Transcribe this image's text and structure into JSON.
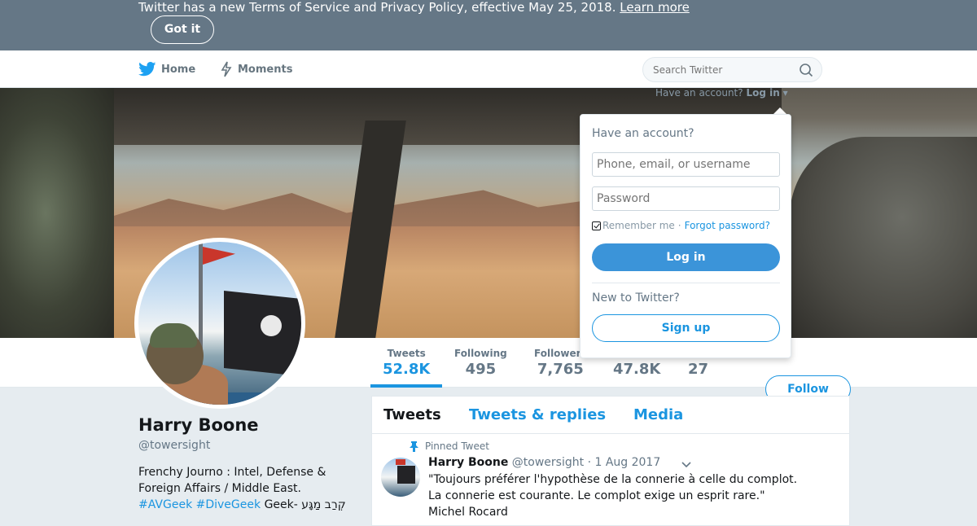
{
  "banner": {
    "text": "Twitter has a new Terms of Service and Privacy Policy, effective May 25, 2018.",
    "learn_more": "Learn more",
    "got_it": "Got it"
  },
  "nav": {
    "home": "Home",
    "moments": "Moments",
    "search_placeholder": "Search Twitter",
    "have_account": "Have an account?",
    "log_in": "Log in"
  },
  "login_dropdown": {
    "title": "Have an account?",
    "username_placeholder": "Phone, email, or username",
    "password_placeholder": "Password",
    "remember_me": "Remember me",
    "separator": "·",
    "forgot_password": "Forgot password?",
    "login_button": "Log in",
    "new_to_twitter": "New to Twitter?",
    "signup_button": "Sign up"
  },
  "stats": [
    {
      "label": "Tweets",
      "value": "52.8K"
    },
    {
      "label": "Following",
      "value": "495"
    },
    {
      "label": "Followers",
      "value": "7,765"
    },
    {
      "label": "",
      "value": "47.8K"
    },
    {
      "label": "",
      "value": "27"
    }
  ],
  "follow_button": "Follow",
  "profile": {
    "name": "Harry Boone",
    "handle": "@towersight",
    "bio_line1": "Frenchy Journo : Intel, Defense &",
    "bio_line2": "Foreign Affairs / Middle East.",
    "bio_tag1": "#AVGeek",
    "bio_tag2": "#DiveGeek",
    "bio_rest": "Geek- קְרַב מַגָּע"
  },
  "timeline": {
    "tabs": [
      "Tweets",
      "Tweets & replies",
      "Media"
    ],
    "pinned_label": "Pinned Tweet",
    "tweet": {
      "name": "Harry Boone",
      "handle": "@towersight",
      "date": "· 1 Aug 2017",
      "line1": "\"Toujours préférer l'hypothèse de la connerie à celle du complot.",
      "line2": "La connerie est courante. Le complot exige un esprit rare.\"",
      "line3": "Michel Rocard"
    }
  },
  "colors": {
    "accent": "#1b95e0",
    "banner_bg": "#657786",
    "login_button_bg": "#3b94d9"
  }
}
